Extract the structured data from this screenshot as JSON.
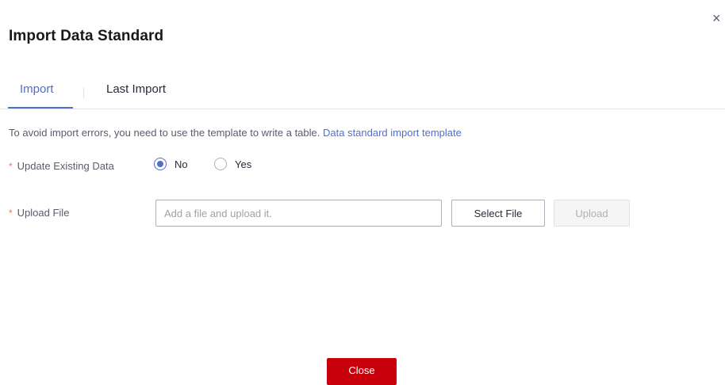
{
  "dialog": {
    "title": "Import Data Standard",
    "close_icon": "×"
  },
  "tabs": [
    {
      "label": "Import",
      "active": true
    },
    {
      "label": "Last Import",
      "active": false
    }
  ],
  "hint": {
    "text": "To avoid import errors, you need to use the template to write a table. ",
    "link": "Data standard import template"
  },
  "form": {
    "required_mark": "*",
    "update_label": "Update Existing Data",
    "update_options": [
      {
        "label": "No",
        "checked": true
      },
      {
        "label": "Yes",
        "checked": false
      }
    ],
    "upload_label": "Upload File",
    "file_placeholder": "Add a file and upload it.",
    "file_value": "",
    "select_button": "Select File",
    "upload_button": "Upload"
  },
  "footer": {
    "close_button": "Close"
  },
  "colors": {
    "accent": "#526ecc",
    "primary_button": "#c7000b",
    "required": "#f66f6a"
  },
  "icons": {
    "close": "close-icon"
  }
}
